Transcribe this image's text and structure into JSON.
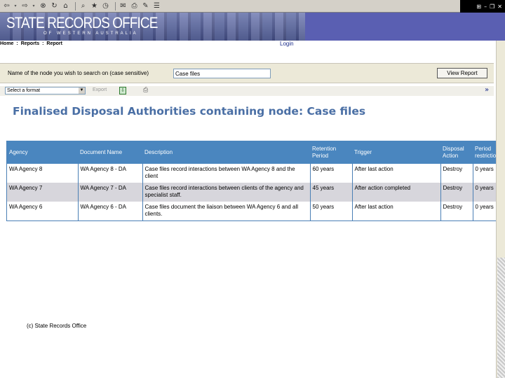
{
  "browser": {
    "toolbar_icons": [
      "back-icon",
      "forward-icon",
      "stop-icon",
      "refresh-icon",
      "home-icon",
      "search-icon",
      "favorites-icon",
      "history-icon",
      "mail-icon",
      "print-icon",
      "edit-icon",
      "discuss-icon"
    ],
    "window_controls": [
      "windows-logo-icon",
      "minimize-icon",
      "restore-icon",
      "close-icon"
    ]
  },
  "banner": {
    "title": "STATE RECORDS OFFICE",
    "subtitle": "OF WESTERN AUSTRALIA"
  },
  "breadcrumb": {
    "items": [
      "Home",
      ":",
      "Reports",
      ":",
      "Report"
    ],
    "login_label": "Login"
  },
  "search": {
    "label": "Name of the node you wish to search on (case sensitive)",
    "value": "Case files",
    "button_label": "View Report"
  },
  "export": {
    "format_placeholder": "Select a format",
    "export_label": "Export"
  },
  "report": {
    "title": "Finalised Disposal Authorities containing node: Case files"
  },
  "table": {
    "columns": [
      "Agency",
      "Document Name",
      "Description",
      "Retention Period",
      "Trigger",
      "Disposal Action",
      "Period restrictions"
    ],
    "rows": [
      [
        "WA Agency 8",
        "WA Agency 8 - DA",
        "Case files record interactions between WA Agency 8 and the client",
        "60 years",
        "After last action",
        "Destroy",
        "0 years"
      ],
      [
        "WA Agency 7",
        "WA Agency 7 - DA",
        "Case files record interactions between clients of the agency and specialist staff.",
        "45 years",
        "After action completed",
        "Destroy",
        "0 years"
      ],
      [
        "WA Agency 6",
        "WA Agency 6 - DA",
        "Case files document the liaison between WA Agency 6 and all clients.",
        "50 years",
        "After last action",
        "Destroy",
        "0 years"
      ]
    ]
  },
  "footer": {
    "text": "(c) State Records Office"
  }
}
